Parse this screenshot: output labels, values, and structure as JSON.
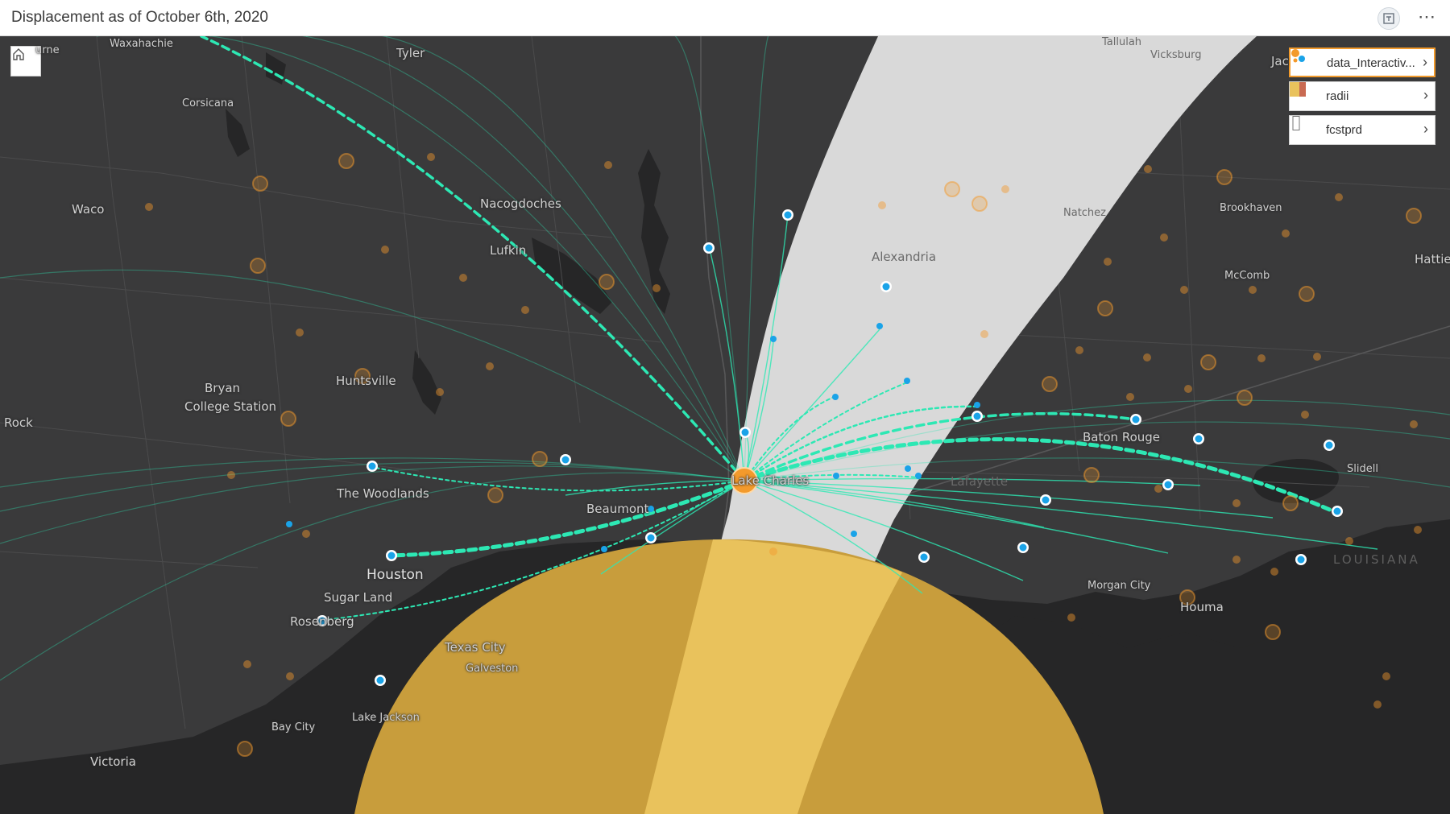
{
  "header": {
    "title": "Displacement as of October 6th, 2020"
  },
  "icons": {
    "home": "home-icon",
    "header_action": "filter-icon",
    "more": "more-icon"
  },
  "colors": {
    "basemap": "#3a3a3b",
    "water": "#262627",
    "forecast_cone": "#d9d9d9",
    "radii": "#e9b84a",
    "flow": "#2de8b4",
    "point": "#1aa3e8",
    "origin": "#f39a2c"
  },
  "legend": {
    "layers": [
      {
        "label": "data_Interactiv...",
        "icon": "points-swatch-icon",
        "active": true
      },
      {
        "label": "radii",
        "icon": "polygon-swatch-icon",
        "active": false
      },
      {
        "label": "fcstprd",
        "icon": "outline-swatch-icon",
        "active": false
      }
    ]
  },
  "map": {
    "labels": [
      {
        "text": "urne",
        "type": "city"
      },
      {
        "text": "Waxahachie",
        "type": "city"
      },
      {
        "text": "Tyler",
        "type": "city"
      },
      {
        "text": "Tallulah",
        "type": "city"
      },
      {
        "text": "Vicksburg",
        "type": "city"
      },
      {
        "text": "Jac",
        "type": "city"
      },
      {
        "text": "Corsicana",
        "type": "city"
      },
      {
        "text": "Nacogdoches",
        "type": "city"
      },
      {
        "text": "Waco",
        "type": "city"
      },
      {
        "text": "Lufkin",
        "type": "city"
      },
      {
        "text": "Alexandria",
        "type": "city"
      },
      {
        "text": "Natchez",
        "type": "city"
      },
      {
        "text": "Brookhaven",
        "type": "city"
      },
      {
        "text": "Hattie",
        "type": "city"
      },
      {
        "text": "McComb",
        "type": "city"
      },
      {
        "text": "Bryan",
        "type": "city"
      },
      {
        "text": "College Station",
        "type": "city"
      },
      {
        "text": "Huntsville",
        "type": "city"
      },
      {
        "text": "Rock",
        "type": "city"
      },
      {
        "text": "Baton Rouge",
        "type": "city"
      },
      {
        "text": "Slidell",
        "type": "city"
      },
      {
        "text": "Lake Charles",
        "type": "city"
      },
      {
        "text": "Lafayette",
        "type": "city"
      },
      {
        "text": "The Woodlands",
        "type": "city"
      },
      {
        "text": "Beaumont",
        "type": "city"
      },
      {
        "text": "Houston",
        "type": "city"
      },
      {
        "text": "Sugar Land",
        "type": "city"
      },
      {
        "text": "Rosenberg",
        "type": "city"
      },
      {
        "text": "Morgan City",
        "type": "city"
      },
      {
        "text": "Houma",
        "type": "city"
      },
      {
        "text": "Texas City",
        "type": "city"
      },
      {
        "text": "Galveston",
        "type": "city"
      },
      {
        "text": "Lake Jackson",
        "type": "city"
      },
      {
        "text": "Bay City",
        "type": "city"
      },
      {
        "text": "Victoria",
        "type": "city"
      },
      {
        "text": "LOUISIANA",
        "type": "state"
      }
    ]
  }
}
